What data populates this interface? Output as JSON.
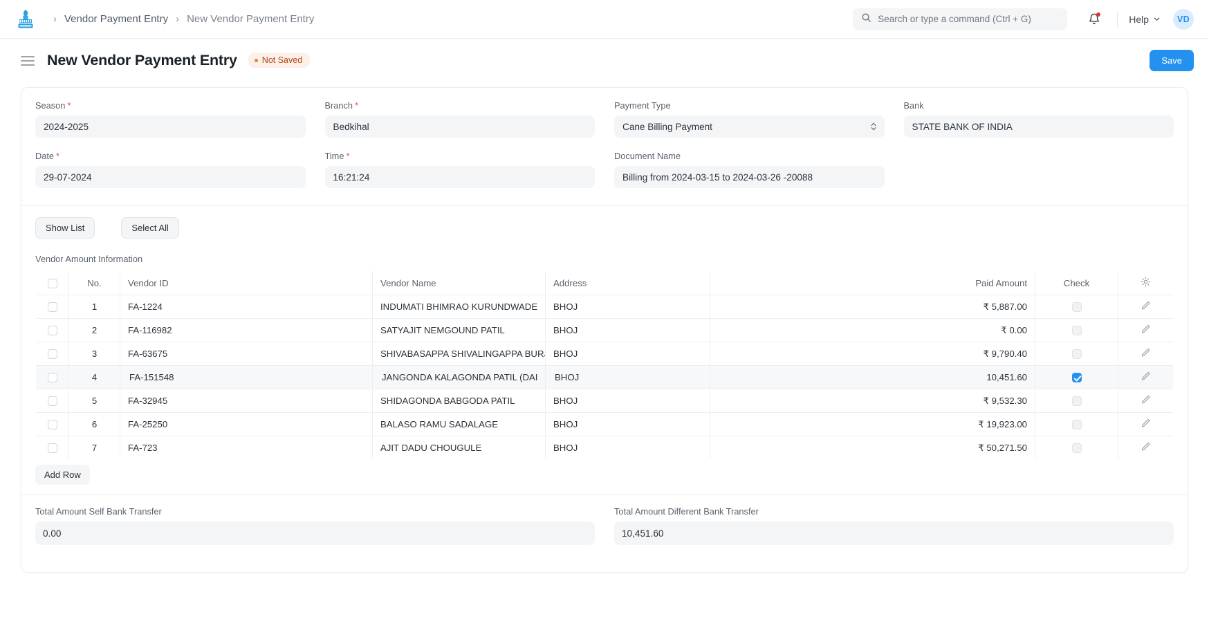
{
  "navbar": {
    "logo_alt": "factory-logo",
    "breadcrumb": [
      {
        "label": "Vendor Payment Entry",
        "active": false
      },
      {
        "label": "New Vendor Payment Entry",
        "active": true
      }
    ],
    "separator": "›",
    "search": {
      "placeholder": "Search or type a command (Ctrl + G)",
      "value": ""
    },
    "help_label": "Help",
    "avatar_initials": "VD"
  },
  "page": {
    "title": "New Vendor Payment Entry",
    "status_badge": "Not Saved",
    "save_label": "Save",
    "accent_color": "#2490ef",
    "badge_color": "#b14a15"
  },
  "form": {
    "season": {
      "label": "Season",
      "required": true,
      "value": "2024-2025"
    },
    "branch": {
      "label": "Branch",
      "required": true,
      "value": "Bedkihal"
    },
    "payment_type": {
      "label": "Payment Type",
      "required": false,
      "value": "Cane Billing Payment"
    },
    "bank": {
      "label": "Bank",
      "required": false,
      "value": "STATE BANK OF INDIA"
    },
    "date": {
      "label": "Date",
      "required": true,
      "value": "29-07-2024"
    },
    "time": {
      "label": "Time",
      "required": true,
      "value": "16:21:24"
    },
    "document_name": {
      "label": "Document Name",
      "required": false,
      "value": "Billing from 2024-03-15 to 2024-03-26 -20088"
    }
  },
  "actions": {
    "show_list": "Show List",
    "select_all": "Select All"
  },
  "grid": {
    "caption": "Vendor Amount Information",
    "columns": [
      "",
      "No.",
      "Vendor ID",
      "Vendor Name",
      "Address",
      "Paid Amount",
      "Check",
      ""
    ],
    "add_row_label": "Add Row",
    "rows": [
      {
        "no": "1",
        "vendor_id": "FA-1224",
        "vendor_name": "INDUMATI BHIMRAO KURUNDWADE",
        "address": "BHOJ",
        "paid_amount": "₹ 5,887.00",
        "check": false,
        "selected": false
      },
      {
        "no": "2",
        "vendor_id": "FA-116982",
        "vendor_name": "SATYAJIT NEMGOUND PATIL",
        "address": "BHOJ",
        "paid_amount": "₹ 0.00",
        "check": false,
        "selected": false
      },
      {
        "no": "3",
        "vendor_id": "FA-63675",
        "vendor_name": "SHIVABASAPPA SHIVALINGAPPA BURJI",
        "address": "BHOJ",
        "paid_amount": "₹ 9,790.40",
        "check": false,
        "selected": false
      },
      {
        "no": "4",
        "vendor_id": "FA-151548",
        "vendor_name": "JANGONDA KALAGONDA PATIL (DAI",
        "address": "BHOJ",
        "paid_amount": "10,451.60",
        "check": true,
        "selected": true
      },
      {
        "no": "5",
        "vendor_id": "FA-32945",
        "vendor_name": "SHIDAGONDA BABGODA PATIL",
        "address": "BHOJ",
        "paid_amount": "₹ 9,532.30",
        "check": false,
        "selected": false
      },
      {
        "no": "6",
        "vendor_id": "FA-25250",
        "vendor_name": "BALASO RAMU SADALAGE",
        "address": "BHOJ",
        "paid_amount": "₹ 19,923.00",
        "check": false,
        "selected": false
      },
      {
        "no": "7",
        "vendor_id": "FA-723",
        "vendor_name": "AJIT DADU CHOUGULE",
        "address": "BHOJ",
        "paid_amount": "₹ 50,271.50",
        "check": false,
        "selected": false
      }
    ]
  },
  "totals": {
    "self_bank": {
      "label": "Total Amount Self Bank Transfer",
      "value": "0.00"
    },
    "different_bank": {
      "label": "Total Amount Different Bank Transfer",
      "value": "10,451.60"
    }
  }
}
